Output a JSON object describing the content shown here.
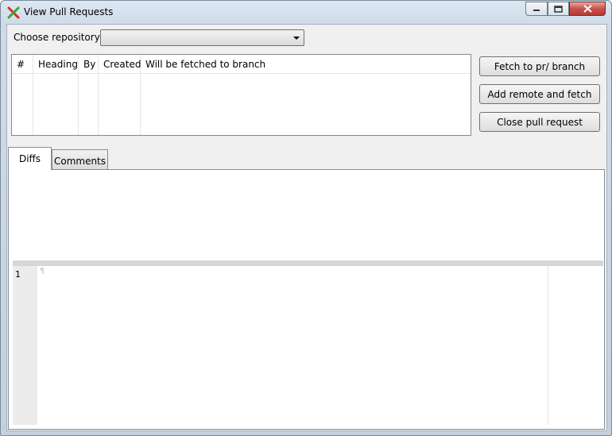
{
  "window": {
    "title": "View Pull Requests",
    "app_icon": "red-green-x-icon",
    "controls": {
      "minimize": "minimize-icon",
      "maximize": "maximize-icon",
      "close": "close-icon"
    }
  },
  "repository": {
    "label": "Choose repository:",
    "selected": ""
  },
  "pull_requests": {
    "columns": [
      "#",
      "Heading",
      "By",
      "Created",
      "Will be fetched to branch"
    ],
    "rows": []
  },
  "actions": {
    "fetch": "Fetch to pr/ branch",
    "add_remote": "Add remote and fetch",
    "close_pr": "Close pull request"
  },
  "tabs": [
    {
      "label": "Diffs",
      "active": true
    },
    {
      "label": "Comments",
      "active": false
    }
  ],
  "editor": {
    "line_numbers": [
      "1"
    ],
    "pilcrow": "¶"
  },
  "colors": {
    "close_button": "#c75050",
    "client_bg": "#f0f0f0",
    "splitter": "#d6d6d6",
    "gutter": "#ececec"
  }
}
